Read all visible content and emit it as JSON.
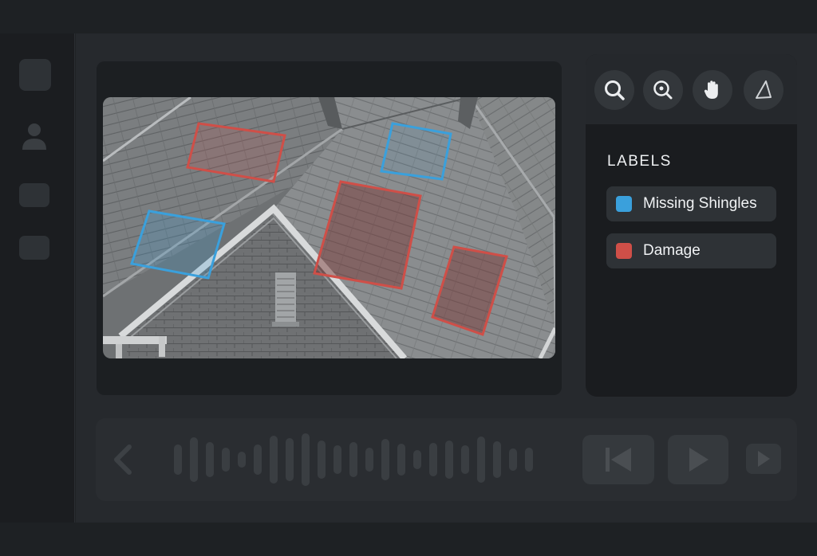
{
  "panel": {
    "labels_title": "LABELS",
    "labels": [
      {
        "name": "Missing Shingles",
        "color": "#3aa0dc"
      },
      {
        "name": "Damage",
        "color": "#cf4f48"
      }
    ]
  },
  "tools": [
    "search-icon",
    "zoom-in-icon",
    "pan-hand-icon",
    "polygon-icon"
  ],
  "annotations": [
    {
      "label": "Damage",
      "color": "#cf4f48"
    },
    {
      "label": "Missing Shingles",
      "color": "#3aa0dc"
    },
    {
      "label": "Missing Shingles",
      "color": "#3aa0dc"
    },
    {
      "label": "Damage",
      "color": "#cf4f48"
    },
    {
      "label": "Damage",
      "color": "#cf4f48"
    }
  ],
  "colors": {
    "accent_blue": "#3aa0dc",
    "accent_red": "#cf4f48",
    "background": "#26292d"
  }
}
